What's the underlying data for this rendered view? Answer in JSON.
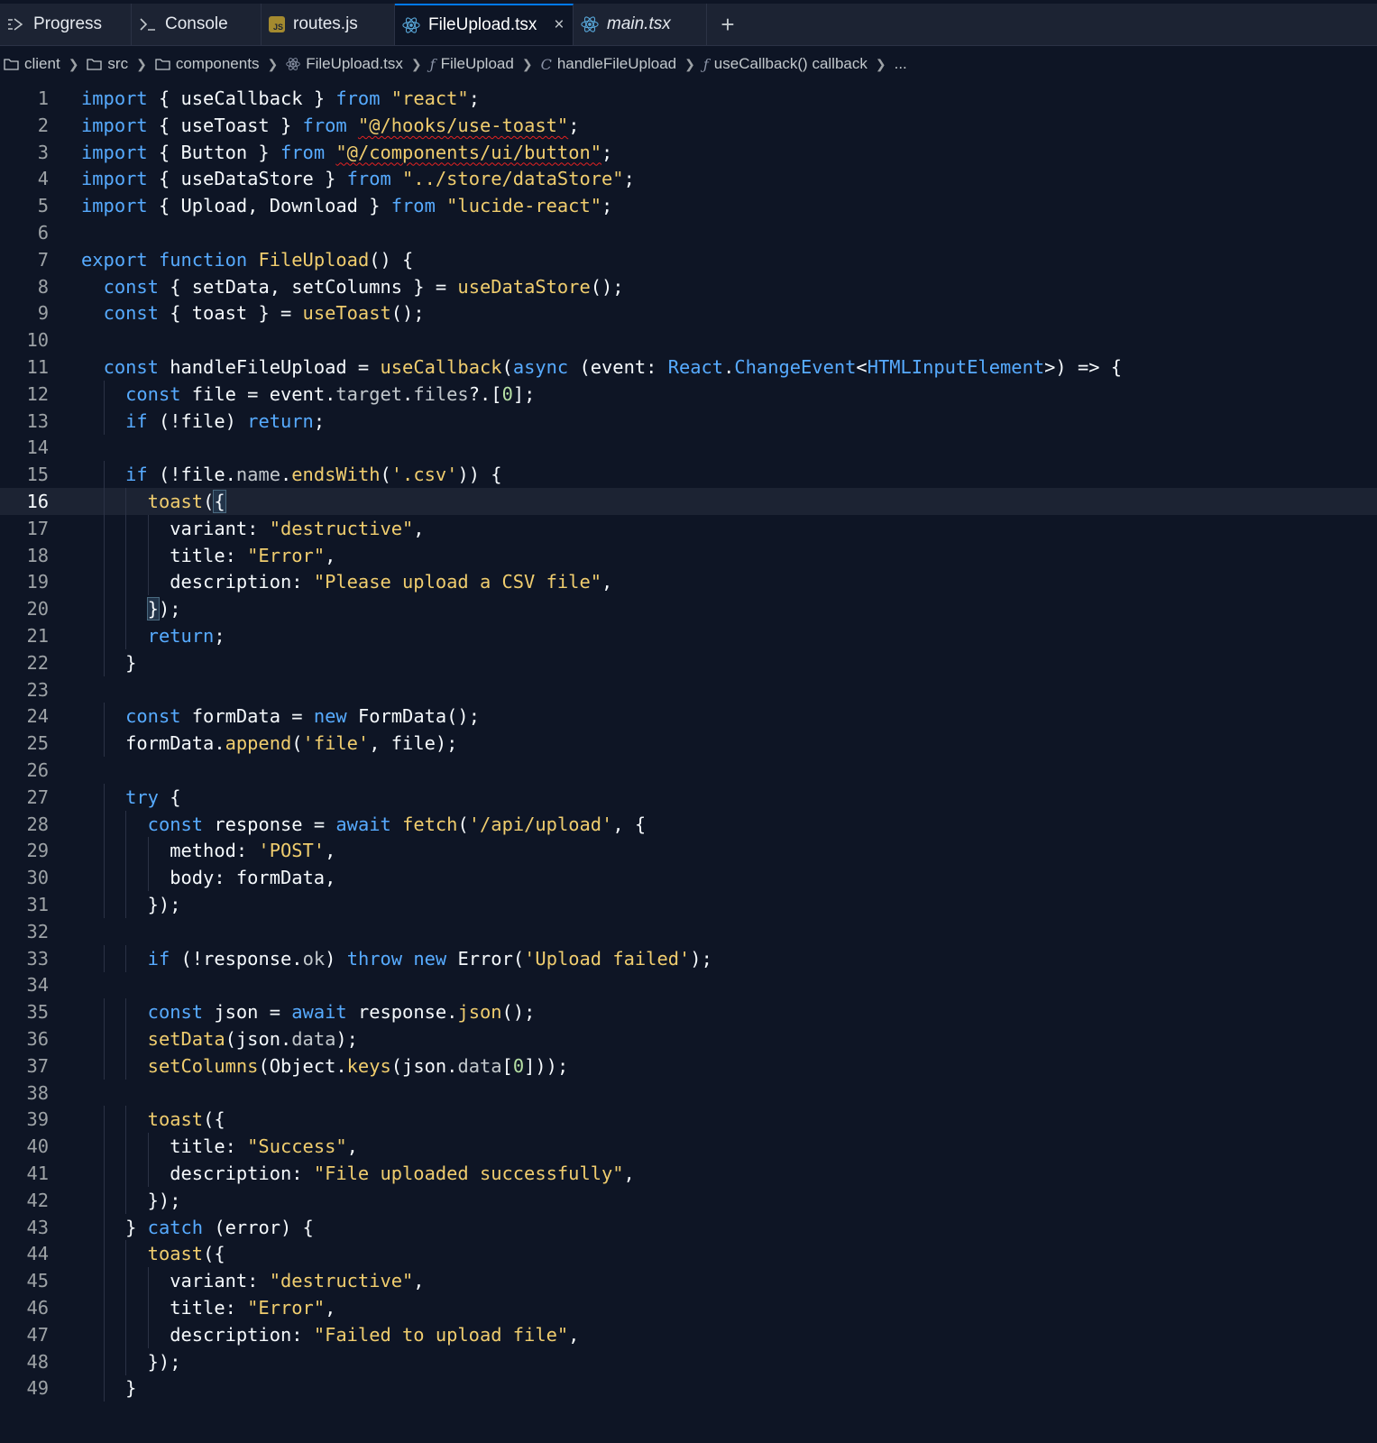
{
  "tabs": [
    {
      "label": "Progress",
      "icon": "progress-icon",
      "active": false
    },
    {
      "label": "Console",
      "icon": "terminal-icon",
      "active": false
    },
    {
      "label": "routes.js",
      "icon": "js-file-icon",
      "active": false
    },
    {
      "label": "FileUpload.tsx",
      "icon": "react-icon",
      "active": true
    },
    {
      "label": "main.tsx",
      "icon": "react-icon",
      "active": false
    }
  ],
  "new_tab_label": "+",
  "close_label": "×",
  "breadcrumb": [
    "client",
    "src",
    "components",
    "FileUpload.tsx",
    "FileUpload",
    "handleFileUpload",
    "useCallback() callback",
    "..."
  ],
  "editor": {
    "current_line": 16,
    "language": "tsx",
    "lines": [
      "import { useCallback } from \"react\";",
      "import { useToast } from \"@/hooks/use-toast\";",
      "import { Button } from \"@/components/ui/button\";",
      "import { useDataStore } from \"../store/dataStore\";",
      "import { Upload, Download } from \"lucide-react\";",
      "",
      "export function FileUpload() {",
      "  const { setData, setColumns } = useDataStore();",
      "  const { toast } = useToast();",
      "",
      "  const handleFileUpload = useCallback(async (event: React.ChangeEvent<HTMLInputElement>) => {",
      "    const file = event.target.files?.[0];",
      "    if (!file) return;",
      "",
      "    if (!file.name.endsWith('.csv')) {",
      "      toast({",
      "        variant: \"destructive\",",
      "        title: \"Error\",",
      "        description: \"Please upload a CSV file\",",
      "      });",
      "      return;",
      "    }",
      "",
      "    const formData = new FormData();",
      "    formData.append('file', file);",
      "",
      "    try {",
      "      const response = await fetch('/api/upload', {",
      "        method: 'POST',",
      "        body: formData,",
      "      });",
      "",
      "      if (!response.ok) throw new Error('Upload failed');",
      "",
      "      const json = await response.json();",
      "      setData(json.data);",
      "      setColumns(Object.keys(json.data[0]));",
      "",
      "      toast({",
      "        title: \"Success\",",
      "        description: \"File uploaded successfully\",",
      "      });",
      "    } catch (error) {",
      "      toast({",
      "        variant: \"destructive\",",
      "        title: \"Error\",",
      "        description: \"Failed to upload file\",",
      "      });",
      "    }"
    ]
  }
}
